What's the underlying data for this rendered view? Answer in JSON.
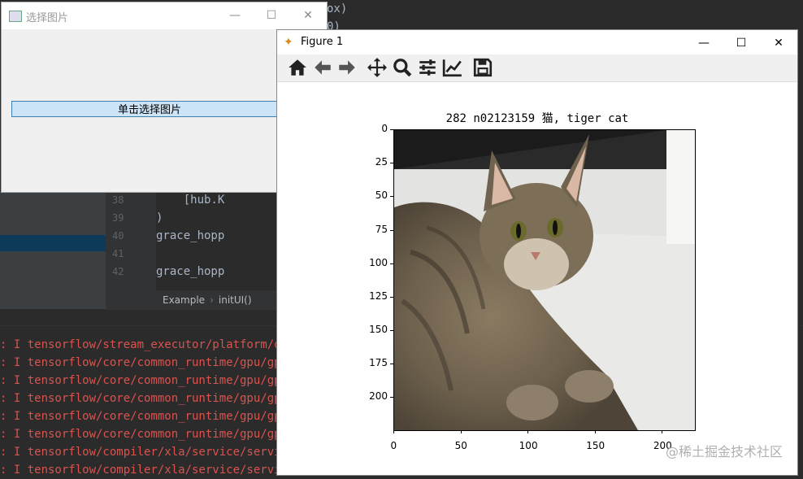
{
  "ide": {
    "code_top": [
      "ox)",
      "0)"
    ],
    "gutter_lines": [
      "38",
      "39",
      "40",
      "41",
      "42"
    ],
    "code_lines": [
      "    [hub.K",
      ")",
      "grace_hopp",
      "",
      "grace_hopp"
    ],
    "breadcrumb": {
      "a": "Example",
      "b": "initUI()"
    },
    "console_lines": [
      ": I tensorflow/stream_executor/platform/def",
      ": I tensorflow/core/common_runtime/gpu/gpu_",
      ": I tensorflow/core/common_runtime/gpu/gpu_",
      ": I tensorflow/core/common_runtime/gpu/gpu_",
      ": I tensorflow/core/common_runtime/gpu/gpu_",
      ": I tensorflow/core/common_runtime/gpu/gpu_",
      ": I tensorflow/compiler/xla/service/service",
      ": I tensorflow/compiler/xla/service/service"
    ]
  },
  "qt_window": {
    "title": "选择图片",
    "button_label": "单击选择图片",
    "minimize": "—",
    "maximize": "☐",
    "close": "✕"
  },
  "figure_window": {
    "title": "Figure 1",
    "minimize": "—",
    "maximize": "☐",
    "close": "✕",
    "toolbar": [
      "home-icon",
      "back-icon",
      "forward-icon",
      "pan-icon",
      "zoom-icon",
      "configure-subplots-icon",
      "edit-axis-icon",
      "save-icon"
    ]
  },
  "chart_data": {
    "type": "image",
    "title": "282 n02123159 猫, tiger cat",
    "xlabel": "",
    "ylabel": "",
    "xlim": [
      0,
      224
    ],
    "ylim": [
      224,
      0
    ],
    "xticks": [
      "0",
      "50",
      "100",
      "150",
      "200"
    ],
    "yticks": [
      "0",
      "25",
      "50",
      "75",
      "100",
      "125",
      "150",
      "175",
      "200"
    ]
  },
  "watermark": "@稀土掘金技术社区"
}
